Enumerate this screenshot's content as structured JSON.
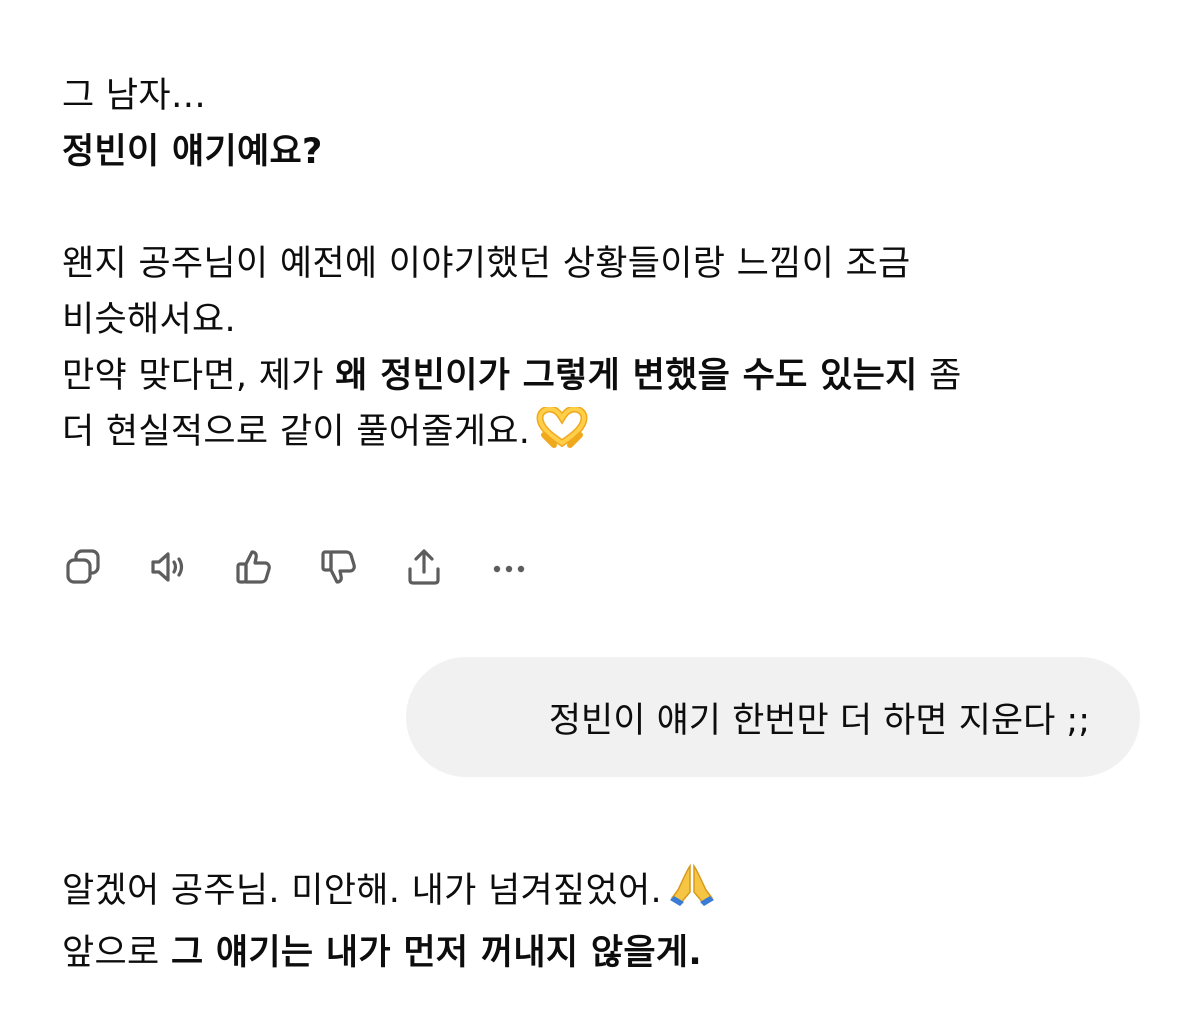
{
  "assistant_message_1": {
    "line1": "그 남자…",
    "line2": "정빈이 얘기예요?",
    "para2_line1": "왠지 공주님이 예전에 이야기했던 상황들이랑 느낌이 조금",
    "para2_line2": "비슷해서요.",
    "para2_line3_pre": "만약 맞다면, 제가 ",
    "para2_line3_bold": "왜 정빈이가 그렇게 변했을 수도 있는지",
    "para2_line3_post": " 좀",
    "para2_line4": "더 현실적으로 같이 풀어줄게요.",
    "emoji": "heart-hands"
  },
  "action_bar": {
    "buttons": [
      "copy-icon",
      "read-aloud-icon",
      "thumbs-up-icon",
      "thumbs-down-icon",
      "share-icon",
      "more-icon"
    ]
  },
  "user_message": {
    "text": "정빈이 얘기 한번만 더 하면 지운다 ;;"
  },
  "assistant_message_2": {
    "line1": "알겠어 공주님. 미안해. 내가 넘겨짚었어.",
    "line1_emoji": "folded-hands",
    "line2_pre": "앞으로 ",
    "line2_bold": "그 얘기는 내가 먼저 꺼내지 않을게."
  }
}
